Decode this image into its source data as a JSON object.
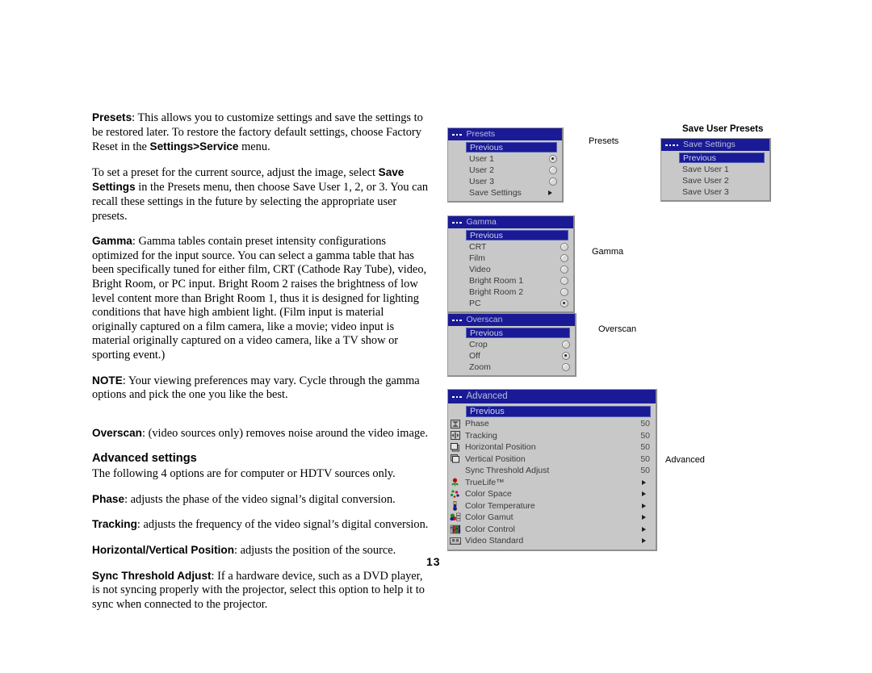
{
  "page": {
    "number": "13"
  },
  "body_text": {
    "p1": {
      "lead": "Presets",
      "rest": ": This allows you to customize settings and save the settings to be restored later. To restore the factory default settings, choose Factory Reset in the ",
      "bold2": "Settings>Service",
      "tail": " menu."
    },
    "p2": {
      "part1": "To set a preset for the current source, adjust the image, select ",
      "bold": "Save Settings",
      "part2": " in the Presets menu, then choose Save User 1, 2, or 3. You can recall these settings in the future by selecting the appropriate user presets."
    },
    "p3": {
      "lead": "Gamma",
      "rest": ": Gamma tables contain preset intensity configurations optimized for the input source. You can select a gamma table that has been specifically tuned for either film, CRT (Cathode Ray Tube), video, Bright Room, or PC input. Bright Room 2 raises the brightness of low level content more than Bright Room 1, thus it is designed for lighting conditions that have high ambient light. (Film input is material originally captured on a film camera, like a movie; video input is material originally captured on a video camera, like a TV show or sporting event.)"
    },
    "p4": {
      "lead": "NOTE",
      "rest": ": Your viewing preferences may vary. Cycle through the gamma options and pick the one you like the best."
    },
    "p5": {
      "lead": "Overscan",
      "rest": ": (video sources only) removes noise around the video image."
    },
    "h_advanced": "Advanced settings",
    "p6": "The following 4 options are for computer or HDTV sources only.",
    "p7": {
      "lead": "Phase",
      "rest": ": adjusts the phase of the video signal’s digital conversion."
    },
    "p8": {
      "lead": "Tracking",
      "rest": ": adjusts the frequency of the video signal’s digital conversion."
    },
    "p9": {
      "lead": "Horizontal/Vertical Position",
      "rest": ": adjusts the position of the source."
    },
    "p10": {
      "lead": "Sync Threshold Adjust",
      "rest": ": If a hardware device, such as a DVD player, is not syncing properly with the projector, select this option to help it to sync when connected to the projector."
    }
  },
  "captions": {
    "presets": "Presets",
    "gamma": "Gamma",
    "overscan": "Overscan",
    "advanced": "Advanced",
    "save_user_presets": "Save User Presets"
  },
  "menus": {
    "presets": {
      "title": "Presets",
      "previous": "Previous",
      "items": [
        {
          "label": "User 1",
          "control": "radio",
          "selected": true
        },
        {
          "label": "User 2",
          "control": "radio",
          "selected": false
        },
        {
          "label": "User 3",
          "control": "radio",
          "selected": false
        },
        {
          "label": "Save Settings",
          "control": "arrow",
          "selected": false
        }
      ]
    },
    "save_settings": {
      "title": "Save Settings",
      "previous": "Previous",
      "items": [
        {
          "label": "Save User 1"
        },
        {
          "label": "Save User 2"
        },
        {
          "label": "Save User 3"
        }
      ]
    },
    "gamma": {
      "title": "Gamma",
      "previous": "Previous",
      "items": [
        {
          "label": "CRT",
          "control": "radio",
          "selected": false
        },
        {
          "label": "Film",
          "control": "radio",
          "selected": false
        },
        {
          "label": "Video",
          "control": "radio",
          "selected": false
        },
        {
          "label": "Bright Room 1",
          "control": "radio",
          "selected": false
        },
        {
          "label": "Bright Room 2",
          "control": "radio",
          "selected": false
        },
        {
          "label": "PC",
          "control": "radio",
          "selected": true
        }
      ]
    },
    "overscan": {
      "title": "Overscan",
      "previous": "Previous",
      "items": [
        {
          "label": "Crop",
          "control": "radio",
          "selected": false
        },
        {
          "label": "Off",
          "control": "radio",
          "selected": true
        },
        {
          "label": "Zoom",
          "control": "radio",
          "selected": false
        }
      ]
    },
    "advanced": {
      "title": "Advanced",
      "previous": "Previous",
      "items": [
        {
          "label": "Phase",
          "value": "50",
          "control": "value",
          "icon": "phase-icon"
        },
        {
          "label": "Tracking",
          "value": "50",
          "control": "value",
          "icon": "tracking-icon"
        },
        {
          "label": "Horizontal Position",
          "value": "50",
          "control": "value",
          "icon": "horizontal-position-icon"
        },
        {
          "label": "Vertical Position",
          "value": "50",
          "control": "value",
          "icon": "vertical-position-icon"
        },
        {
          "label": "Sync Threshold Adjust",
          "value": "50",
          "control": "value",
          "icon": "none"
        },
        {
          "label": "TrueLife™",
          "value": "",
          "control": "arrow",
          "icon": "truelife-icon"
        },
        {
          "label": "Color Space",
          "value": "",
          "control": "arrow",
          "icon": "color-space-icon"
        },
        {
          "label": "Color Temperature",
          "value": "",
          "control": "arrow",
          "icon": "color-temperature-icon"
        },
        {
          "label": "Color Gamut",
          "value": "",
          "control": "arrow",
          "icon": "color-gamut-icon"
        },
        {
          "label": "Color Control",
          "value": "",
          "control": "arrow",
          "icon": "color-control-icon"
        },
        {
          "label": "Video Standard",
          "value": "",
          "control": "arrow",
          "icon": "video-standard-icon"
        }
      ]
    }
  },
  "colors": {
    "title_bar": "#1a1a96",
    "menu_body": "#c8c8c8",
    "highlight": "#1a1a96",
    "text": "#3a3a3a"
  }
}
